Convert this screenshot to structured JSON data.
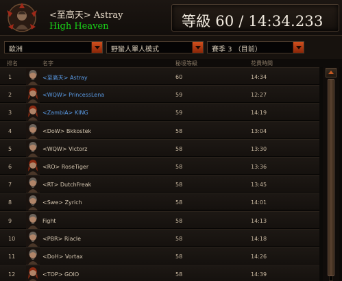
{
  "header": {
    "player_name": "<至高天> Astray",
    "clan_name": "High Heaven",
    "level_time": "等級 60 / 14:34.233"
  },
  "filters": {
    "region": "歐洲",
    "mode": "野蠻人單人模式",
    "season": "賽季 3 （目前）"
  },
  "columns": {
    "rank": "排名",
    "name": "名字",
    "level": "秘境等級",
    "time": "花費時間"
  },
  "rows": [
    {
      "rank": "1",
      "name": "<至高天> Astray",
      "level": "60",
      "time": "14:34",
      "highlight": true,
      "portrait": "male"
    },
    {
      "rank": "2",
      "name": "<WQW> PrincessLena",
      "level": "59",
      "time": "12:27",
      "highlight": true,
      "portrait": "female"
    },
    {
      "rank": "3",
      "name": "<ZambiA> KING",
      "level": "59",
      "time": "14:19",
      "highlight": true,
      "portrait": "female"
    },
    {
      "rank": "4",
      "name": "<DoW> Bkkostek",
      "level": "58",
      "time": "13:04",
      "highlight": false,
      "portrait": "male"
    },
    {
      "rank": "5",
      "name": "<WQW> Victorz",
      "level": "58",
      "time": "13:30",
      "highlight": false,
      "portrait": "male"
    },
    {
      "rank": "6",
      "name": "<RO> RoseTiger",
      "level": "58",
      "time": "13:36",
      "highlight": false,
      "portrait": "female"
    },
    {
      "rank": "7",
      "name": "<RT> DutchFreak",
      "level": "58",
      "time": "13:45",
      "highlight": false,
      "portrait": "male"
    },
    {
      "rank": "8",
      "name": "<Swe> Zyrich",
      "level": "58",
      "time": "14:01",
      "highlight": false,
      "portrait": "male"
    },
    {
      "rank": "9",
      "name": "Fight",
      "level": "58",
      "time": "14:13",
      "highlight": false,
      "portrait": "male"
    },
    {
      "rank": "10",
      "name": "<PBR> Riacle",
      "level": "58",
      "time": "14:18",
      "highlight": false,
      "portrait": "male"
    },
    {
      "rank": "11",
      "name": "<DoH> Vortax",
      "level": "58",
      "time": "14:26",
      "highlight": false,
      "portrait": "male"
    },
    {
      "rank": "12",
      "name": "<TOP> GOIO",
      "level": "58",
      "time": "14:39",
      "highlight": false,
      "portrait": "female"
    }
  ],
  "colors": {
    "clan_green": "#19d419",
    "highlight_blue": "#5a9be6",
    "accent_orange": "#d2501e"
  }
}
